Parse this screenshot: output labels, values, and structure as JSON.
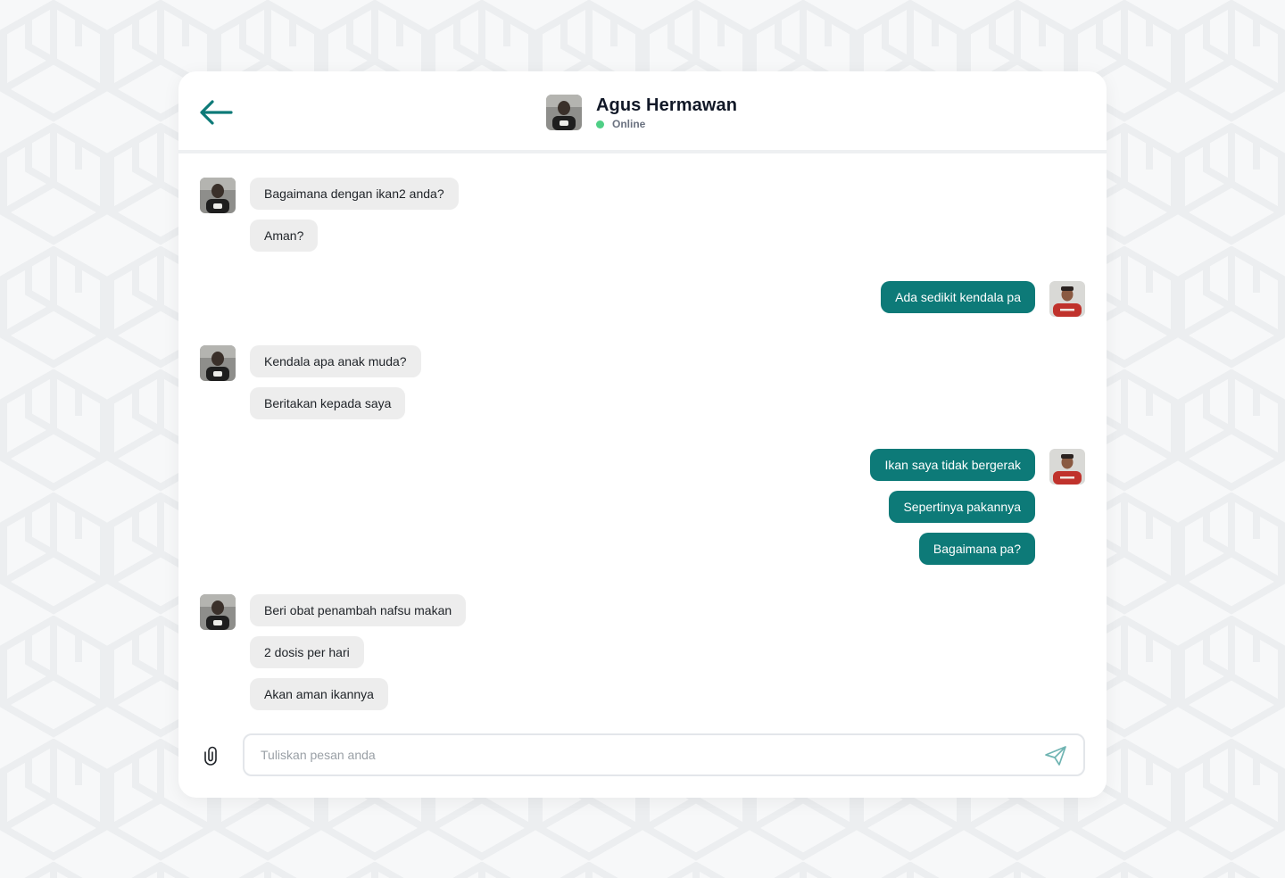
{
  "header": {
    "back_icon": "arrow-left-icon",
    "contact_name": "Agus Hermawan",
    "status": "Online"
  },
  "messages": {
    "group1": [
      "Bagaimana dengan ikan2 anda?",
      "Aman?"
    ],
    "group2": [
      "Ada sedikit kendala pa"
    ],
    "group3": [
      "Kendala apa anak muda?",
      "Beritakan kepada saya"
    ],
    "group4": [
      "Ikan saya tidak bergerak",
      "Sepertinya pakannya",
      "Bagaimana pa?"
    ],
    "group5": [
      "Beri obat penambah nafsu makan",
      "2 dosis per hari",
      "Akan aman ikannya"
    ]
  },
  "composer": {
    "attach_icon": "paperclip-icon",
    "placeholder": "Tuliskan pesan anda",
    "value": "",
    "send_icon": "send-icon"
  },
  "colors": {
    "accent": "#0d7a78",
    "online": "#4fcf86",
    "incoming_bubble": "#ededed",
    "background": "#f7f8f9"
  }
}
